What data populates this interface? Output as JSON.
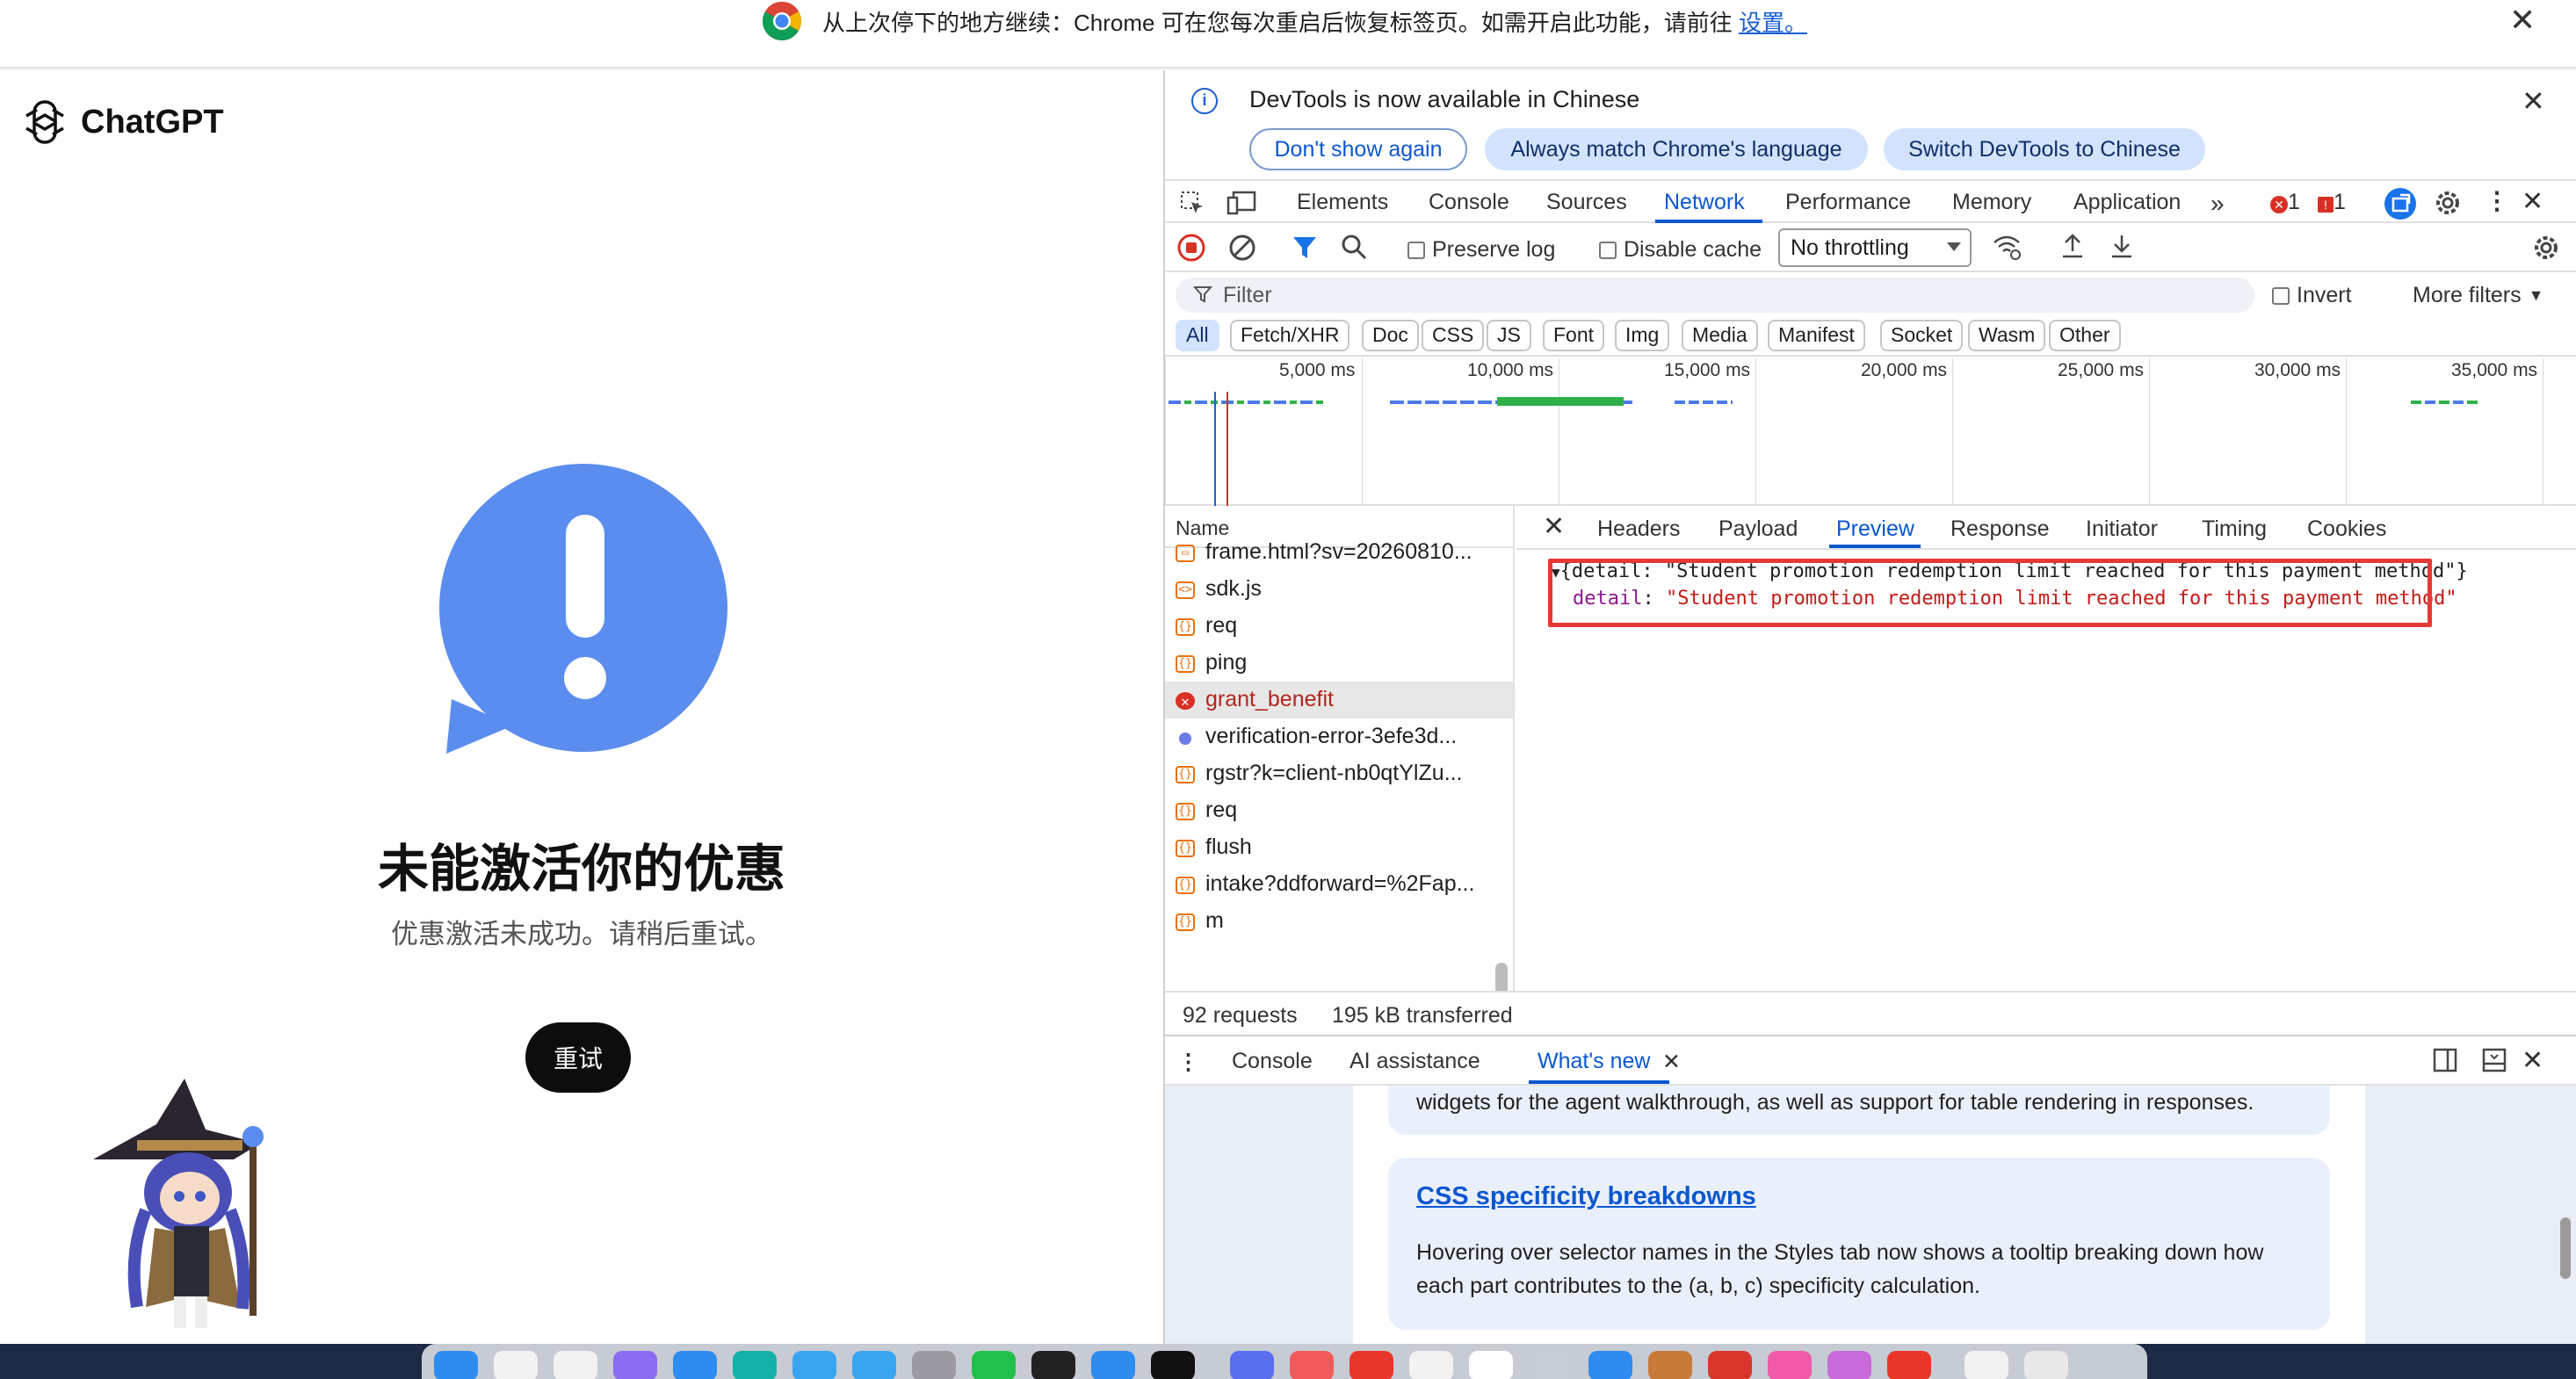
{
  "infobar": {
    "message": "从上次停下的地方继续：Chrome 可在您每次重启后恢复标签页。如需开启此功能，请前往",
    "link": "设置。",
    "close": "✕"
  },
  "page": {
    "logo_text": "ChatGPT",
    "title": "未能激活你的优惠",
    "subtitle": "优惠激活未成功。请稍后重试。",
    "retry": "重试"
  },
  "devtools": {
    "banner": {
      "text": "DevTools is now available in Chinese",
      "btn_dont_show": "Don't show again",
      "btn_match": "Always match Chrome's language",
      "btn_switch": "Switch DevTools to Chinese"
    },
    "tabs": [
      "Elements",
      "Console",
      "Sources",
      "Network",
      "Performance",
      "Memory",
      "Application"
    ],
    "active_tab": "Network",
    "error_count": "1",
    "warning_count": "1",
    "toolbar": {
      "preserve_log": "Preserve log",
      "disable_cache": "Disable cache",
      "throttling": "No throttling"
    },
    "filter": {
      "placeholder": "Filter",
      "invert": "Invert",
      "more_filters": "More filters"
    },
    "types": [
      "All",
      "Fetch/XHR",
      "Doc",
      "CSS",
      "JS",
      "Font",
      "Img",
      "Media",
      "Manifest",
      "Socket",
      "Wasm",
      "Other"
    ],
    "timeline_labels": [
      "5,000 ms",
      "10,000 ms",
      "15,000 ms",
      "20,000 ms",
      "25,000 ms",
      "30,000 ms",
      "35,000 ms"
    ],
    "name_header": "Name",
    "requests": [
      {
        "name": "frame.html?sv=20260810...",
        "icon": "doc"
      },
      {
        "name": "sdk.js",
        "icon": "script"
      },
      {
        "name": "req",
        "icon": "xhr"
      },
      {
        "name": "ping",
        "icon": "xhr"
      },
      {
        "name": "grant_benefit",
        "icon": "error"
      },
      {
        "name": "verification-error-3efe3d...",
        "icon": "info"
      },
      {
        "name": "rgstr?k=client-nb0qtYlZu...",
        "icon": "xhr"
      },
      {
        "name": "req",
        "icon": "xhr"
      },
      {
        "name": "flush",
        "icon": "xhr"
      },
      {
        "name": "intake?ddforward=%2Fap...",
        "icon": "xhr"
      },
      {
        "name": "m",
        "icon": "xhr"
      }
    ],
    "detail_tabs": [
      "Headers",
      "Payload",
      "Preview",
      "Response",
      "Initiator",
      "Timing",
      "Cookies"
    ],
    "active_detail_tab": "Preview",
    "preview": {
      "summary": "{detail: \"Student promotion redemption limit reached for this payment method\"}",
      "key": "detail",
      "value": "\"Student promotion redemption limit reached for this payment method\""
    },
    "summary": {
      "requests": "92 requests",
      "transferred": "195 kB transferred"
    },
    "drawer": {
      "tabs": [
        "Console",
        "AI assistance",
        "What's new"
      ],
      "active": "What's new",
      "card1_text": "widgets for the agent walkthrough, as well as support for table rendering in responses.",
      "card2_title": "CSS specificity breakdowns",
      "card2_text": "Hovering over selector names in the Styles tab now shows a tooltip breaking down how each part contributes to the (a, b, c) specificity calculation."
    }
  },
  "colors": {
    "accent": "#0b57d0",
    "error": "#d93025",
    "bubble": "#5b8def",
    "highlight_box": "#e53935"
  }
}
